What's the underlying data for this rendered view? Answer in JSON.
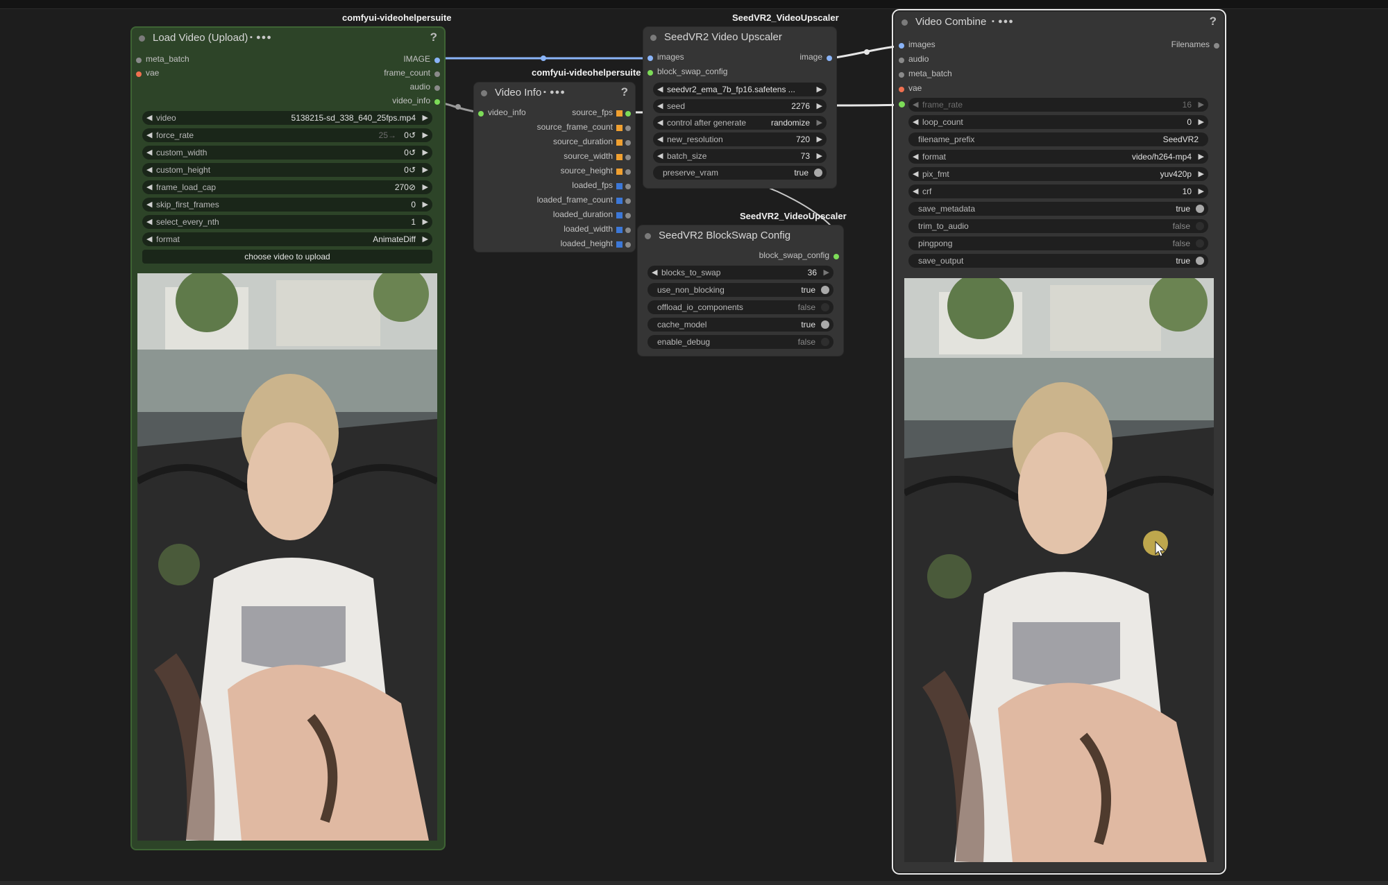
{
  "colors": {
    "canvas": "#1d1d1d",
    "node_bg": "#353535",
    "load_video_bg": "#2d4428",
    "link_blue": "#8ab4f8",
    "link_white": "#e6e6e6",
    "slot_orange": "#f0a030",
    "slot_blue": "#3c78d8",
    "slot_green": "#7ddc58"
  },
  "tags": {
    "vhs_load": "comfyui-videohelpersuite",
    "vhs_info": "comfyui-videohelpersuite",
    "seed_upscaler": "SeedVR2_VideoUpscaler",
    "seed_blockswap": "SeedVR2_VideoUpscaler"
  },
  "load_video": {
    "title": "Load Video (Upload)",
    "help": "?",
    "inputs": [
      "meta_batch",
      "vae"
    ],
    "outputs": [
      "IMAGE",
      "frame_count",
      "audio",
      "video_info"
    ],
    "widgets": [
      {
        "label": "video",
        "value": "5138215-sd_338_640_25fps.mp4"
      },
      {
        "label": "force_rate",
        "value": "0↺",
        "hint": "25→"
      },
      {
        "label": "custom_width",
        "value": "0↺"
      },
      {
        "label": "custom_height",
        "value": "0↺"
      },
      {
        "label": "frame_load_cap",
        "value": "270⊘"
      },
      {
        "label": "skip_first_frames",
        "value": "0"
      },
      {
        "label": "select_every_nth",
        "value": "1"
      },
      {
        "label": "format",
        "value": "AnimateDiff"
      }
    ],
    "upload_button": "choose video to upload"
  },
  "video_info": {
    "title": "Video Info",
    "help": "?",
    "input": "video_info",
    "outputs": [
      "source_fps",
      "source_frame_count",
      "source_duration",
      "source_width",
      "source_height",
      "loaded_fps",
      "loaded_frame_count",
      "loaded_duration",
      "loaded_width",
      "loaded_height"
    ]
  },
  "upscaler": {
    "title": "SeedVR2 Video Upscaler",
    "inputs": [
      "images",
      "block_swap_config"
    ],
    "output": "image",
    "model": "seedvr2_ema_7b_fp16.safetens ...",
    "widgets": [
      {
        "label": "seed",
        "value": "2276"
      },
      {
        "label": "control after generate",
        "value": "randomize"
      },
      {
        "label": "new_resolution",
        "value": "720"
      },
      {
        "label": "batch_size",
        "value": "73"
      }
    ],
    "toggles": [
      {
        "label": "preserve_vram",
        "value": "true",
        "on": true
      }
    ]
  },
  "blockswap": {
    "title": "SeedVR2 BlockSwap Config",
    "output": "block_swap_config",
    "widgets": [
      {
        "label": "blocks_to_swap",
        "value": "36"
      }
    ],
    "toggles": [
      {
        "label": "use_non_blocking",
        "value": "true",
        "on": true
      },
      {
        "label": "offload_io_components",
        "value": "false",
        "on": false
      },
      {
        "label": "cache_model",
        "value": "true",
        "on": true
      },
      {
        "label": "enable_debug",
        "value": "false",
        "on": false
      }
    ]
  },
  "video_combine": {
    "title": "Video Combine",
    "help": "?",
    "inputs": [
      "images",
      "audio",
      "meta_batch",
      "vae"
    ],
    "output": "Filenames",
    "widgets": [
      {
        "label": "frame_rate",
        "value": "16",
        "muted": true
      },
      {
        "label": "loop_count",
        "value": "0"
      },
      {
        "label": "filename_prefix",
        "value": "SeedVR2",
        "plain": true
      },
      {
        "label": "format",
        "value": "video/h264-mp4"
      },
      {
        "label": "pix_fmt",
        "value": "yuv420p"
      },
      {
        "label": "crf",
        "value": "10"
      }
    ],
    "toggles": [
      {
        "label": "save_metadata",
        "value": "true",
        "on": true
      },
      {
        "label": "trim_to_audio",
        "value": "false",
        "on": false
      },
      {
        "label": "pingpong",
        "value": "false",
        "on": false
      },
      {
        "label": "save_output",
        "value": "true",
        "on": true
      }
    ]
  },
  "icons": [
    "node-collapse-dot",
    "badge-icon",
    "arrow-left-icon",
    "arrow-right-icon",
    "toggle-knob",
    "mouse-cursor-icon"
  ]
}
